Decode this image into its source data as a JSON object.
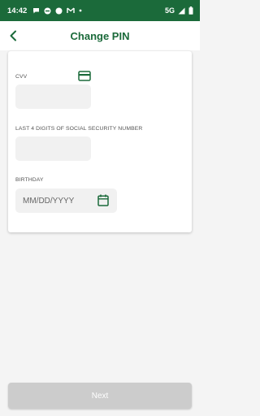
{
  "status_bar": {
    "time": "14:42",
    "network": "5G",
    "left_icons": [
      "chat-bubble-icon",
      "no-entry-icon",
      "dot-icon",
      "gmail-icon",
      "small-dot-icon"
    ],
    "right_icons": [
      "signal-icon",
      "battery-icon"
    ]
  },
  "header": {
    "title": "Change PIN",
    "back_icon": "chevron-left-icon"
  },
  "form": {
    "cvv": {
      "label": "CVV",
      "placeholder": "",
      "value": "",
      "icon": "credit-card-icon"
    },
    "ssn": {
      "label": "LAST 4 DIGITS OF SOCIAL SECURITY NUMBER",
      "placeholder": "",
      "value": ""
    },
    "birthday": {
      "label": "BIRTHDAY",
      "placeholder": "MM/DD/YYYY",
      "value": "",
      "icon": "calendar-icon"
    }
  },
  "footer": {
    "next_label": "Next",
    "next_enabled": false
  },
  "colors": {
    "brand_green": "#1b6a3a",
    "disabled_button": "#cccccc",
    "input_background": "#f1f1f1",
    "page_background": "#f4f4f4"
  }
}
